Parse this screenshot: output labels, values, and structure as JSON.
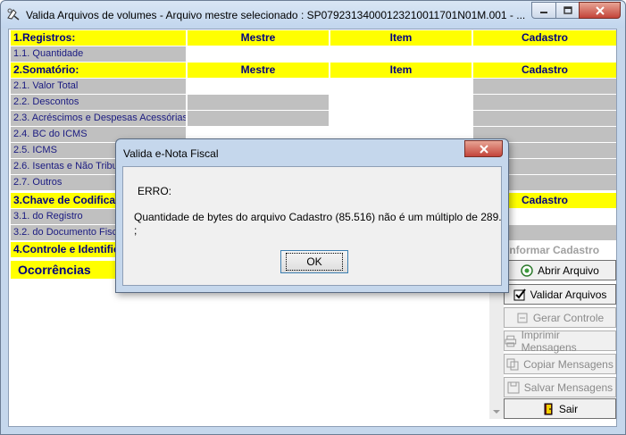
{
  "window": {
    "title": "Valida Arquivos de volumes - Arquivo mestre selecionado : SP07923134000123210011701N01M.001  - ...",
    "min_glyph": "—",
    "max_glyph": "☐",
    "close_glyph": "✕"
  },
  "grid": {
    "section1": {
      "label": "1.Registros:",
      "col1": "Mestre",
      "col2": "Item",
      "col3": "Cadastro"
    },
    "row_1_1": "1.1. Quantidade",
    "section2": {
      "label": "2.Somatório:",
      "col1": "Mestre",
      "col2": "Item",
      "col3": "Cadastro"
    },
    "row_2_1": "2.1. Valor Total",
    "row_2_2": "2.2. Descontos",
    "row_2_3": "2.3. Acréscimos e Despesas Acessórias",
    "row_2_4": "2.4. BC do ICMS",
    "row_2_5": "2.5. ICMS",
    "row_2_6": "2.6. Isentas e Não Tributadas",
    "row_2_7": "2.7. Outros",
    "section3": {
      "label": "3.Chave de Codificação",
      "col3": "Cadastro"
    },
    "row_3_1": "3.1. do Registro",
    "row_3_2": "3.2. do Documento Fiscal",
    "section4": {
      "label": "4.Controle e Identificação"
    },
    "ocorrencias": "Ocorrências"
  },
  "side_panel": {
    "inform_label": "Informar Cadastro",
    "buttons": {
      "abrir": {
        "label": "Abrir Arquivo",
        "accel": "A"
      },
      "validar": {
        "label": "Validar Arquivos",
        "accel": "V"
      },
      "gerar": {
        "label": "Gerar Controle",
        "accel": "G"
      },
      "imprimir": {
        "label": "Imprimir Mensagens",
        "accel": "I"
      },
      "copiar": {
        "label": "Copiar Mensagens",
        "accel": "C"
      },
      "salvar": {
        "label": "Salvar Mensagens",
        "accel": "S"
      },
      "sair": {
        "label": "Sair",
        "accel": "S"
      }
    }
  },
  "dialog": {
    "title": "Valida e-Nota Fiscal",
    "close_glyph": "✕",
    "error_heading": "ERRO:",
    "message": "Quantidade de bytes do arquivo Cadastro (85.516) não é um múltiplo de 289.",
    "message_tail": ";",
    "ok_label": "OK"
  },
  "colors": {
    "header_yellow": "#ffff00",
    "grey_cell": "#c0c0c0",
    "label_text": "#1a1a80",
    "window_frame": "#c5d7ec",
    "close_red": "#c3443a"
  }
}
